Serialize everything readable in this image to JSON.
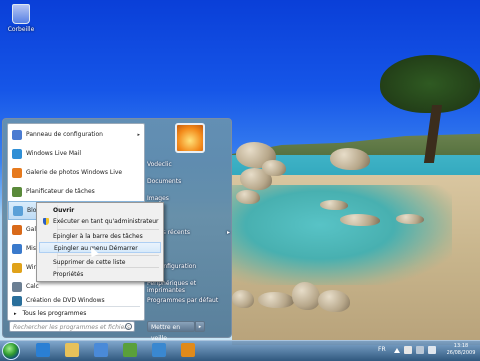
{
  "desktop": {
    "recycle_bin_label": "Corbeille"
  },
  "start_menu": {
    "programs": [
      {
        "label": "Panneau de configuration",
        "icon": "control-panel-icon",
        "color": "#4a7bd1",
        "has_arrow": true,
        "arrow": "▸"
      },
      {
        "label": "Windows Live Mail",
        "icon": "live-mail-icon",
        "color": "#2f8fd6",
        "has_arrow": false
      },
      {
        "label": "Galerie de photos Windows Live",
        "icon": "photo-gallery-icon",
        "color": "#e67a1e",
        "has_arrow": false
      },
      {
        "label": "Planificateur de tâches",
        "icon": "task-scheduler-icon",
        "color": "#5a8a3a",
        "has_arrow": false
      },
      {
        "label": "Bloc-notes",
        "icon": "notepad-icon",
        "color": "#5aa0d8",
        "has_arrow": true,
        "arrow": "▸"
      },
      {
        "label": "Gale",
        "icon": "gallery-icon",
        "color": "#d96a1a",
        "has_arrow": false
      },
      {
        "label": "Mise",
        "icon": "update-icon",
        "color": "#3a7acc",
        "has_arrow": false
      },
      {
        "label": "Wind",
        "icon": "media-player-icon",
        "color": "#e0a21a",
        "has_arrow": false
      },
      {
        "label": "Calc",
        "icon": "calculator-icon",
        "color": "#6b7f93",
        "has_arrow": false
      },
      {
        "label": "Création de DVD Windows",
        "icon": "dvd-maker-icon",
        "color": "#2a6f9b",
        "has_arrow": false
      }
    ],
    "all_programs_label": "Tous les programmes",
    "all_programs_arrow": "▸",
    "search_placeholder": "Rechercher les programmes et fichiers",
    "right_items": [
      {
        "label": "Vodeclic",
        "has_arrow": false
      },
      {
        "label": "Documents",
        "has_arrow": false
      },
      {
        "label": "Images",
        "has_arrow": false
      },
      {
        "label": "ue",
        "has_arrow": false
      },
      {
        "label": "ments récents",
        "has_arrow": true,
        "arrow": "▸"
      },
      {
        "label": "teur",
        "has_arrow": false
      },
      {
        "label": "de configuration",
        "has_arrow": false
      },
      {
        "label": "Périphériques et imprimantes",
        "has_arrow": false
      },
      {
        "label": "Programmes par défaut",
        "has_arrow": false
      }
    ],
    "shutdown_label": "Mettre en veille",
    "shutdown_arrow": "▸"
  },
  "context_menu": {
    "items": [
      {
        "label": "Ouvrir",
        "bold": true
      },
      {
        "label": "Exécuter en tant qu'administrateur",
        "shield": true
      },
      {
        "label": "Epingler à la barre des tâches"
      },
      {
        "label": "Epingler au menu Démarrer",
        "highlight": true
      },
      {
        "label": "Supprimer de cette liste"
      },
      {
        "label": "Propriétés"
      }
    ]
  },
  "taskbar": {
    "pinned": [
      {
        "icon": "internet-explorer-icon",
        "color": "#2a7fd4"
      },
      {
        "icon": "explorer-folder-icon",
        "color": "#e7c15a"
      },
      {
        "icon": "control-panel-icon",
        "color": "#4a8ad8"
      },
      {
        "icon": "windows-live-icon",
        "color": "#5aa03a"
      },
      {
        "icon": "mail-icon",
        "color": "#3a88d0"
      },
      {
        "icon": "media-icon",
        "color": "#e08a1a"
      }
    ],
    "tray": {
      "language": "FR",
      "time": "13:18",
      "date": "26/08/2009"
    }
  }
}
